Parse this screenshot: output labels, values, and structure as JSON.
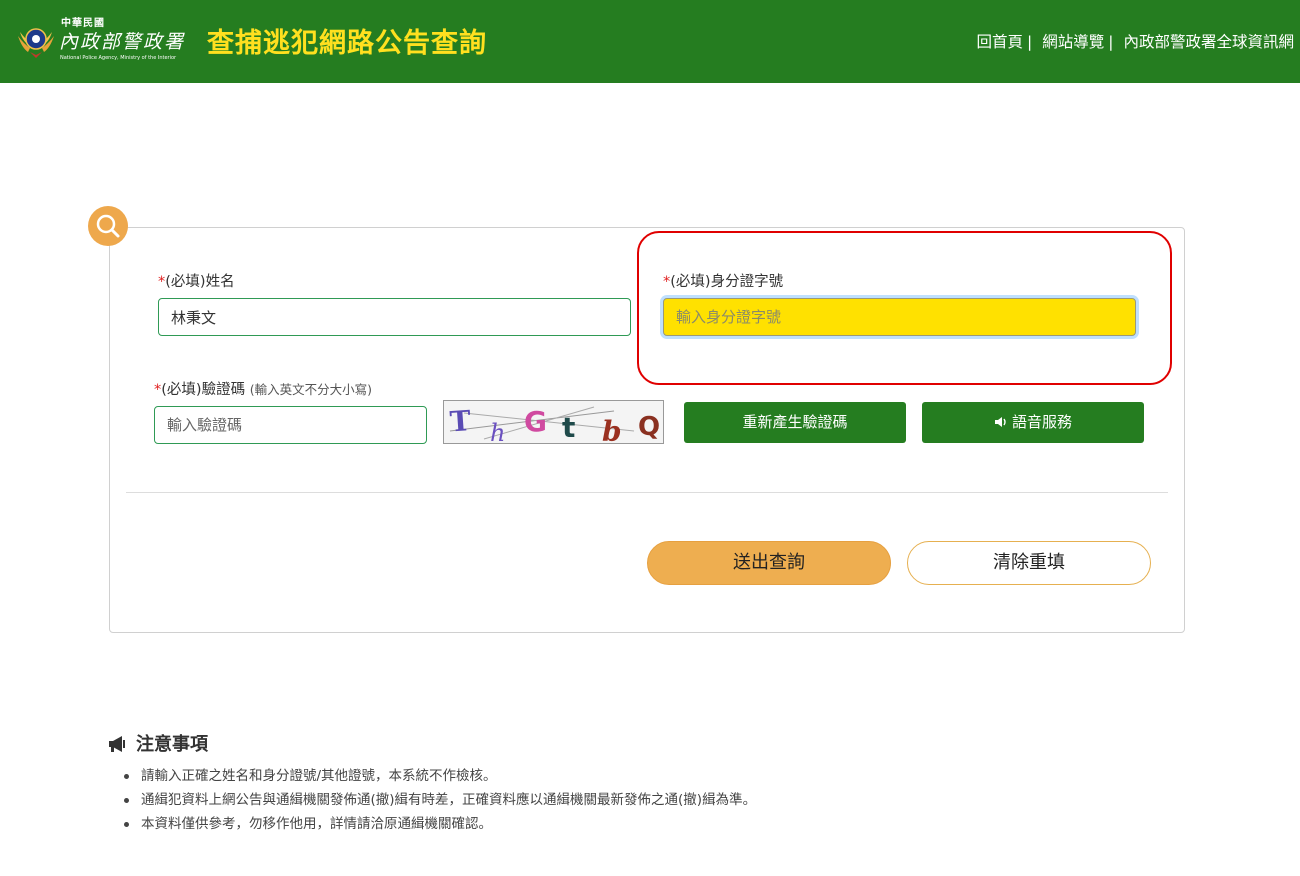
{
  "header": {
    "logo": {
      "line1": "中華民國",
      "line2": "內政部警政署",
      "line3": "National Police Agency, Ministry of the Interior"
    },
    "title": "查捕逃犯網路公告查詢",
    "nav": [
      {
        "label": "回首頁"
      },
      {
        "label": "網站導覽"
      },
      {
        "label": "內政部警政署全球資訊網"
      }
    ],
    "nav_separator": "|"
  },
  "form": {
    "name": {
      "required": "*",
      "label": "(必填)姓名",
      "value": "林秉文"
    },
    "id_number": {
      "required": "*",
      "label": "(必填)身分證字號",
      "placeholder": "輸入身分證字號",
      "value": ""
    },
    "captcha": {
      "required": "*",
      "label": "(必填)驗證碼",
      "hint": "(輸入英文不分大小寫)",
      "placeholder": "輸入驗證碼",
      "image_chars": [
        "T",
        "h",
        "G",
        "t",
        "b",
        "Q"
      ]
    },
    "regen_button": "重新產生驗證碼",
    "audio_button": "語音服務",
    "submit_button": "送出查詢",
    "reset_button": "清除重填"
  },
  "notes": {
    "title": "注意事項",
    "items": [
      "請輸入正確之姓名和身分證號/其他證號，本系統不作檢核。",
      "通緝犯資料上網公告與通緝機關發佈通(撤)緝有時差，正確資料應以通緝機關最新發佈之通(撤)緝為準。",
      "本資料僅供參考，勿移作他用，詳情請洽原通緝機關確認。"
    ]
  },
  "colors": {
    "header_green": "#257d20",
    "title_yellow": "#ffe01f",
    "accent_orange": "#eea84c",
    "highlight_red": "#e00000",
    "focused_field": "#ffe100"
  },
  "icons": [
    "police-emblem-icon",
    "search-icon",
    "volume-icon",
    "megaphone-icon"
  ]
}
